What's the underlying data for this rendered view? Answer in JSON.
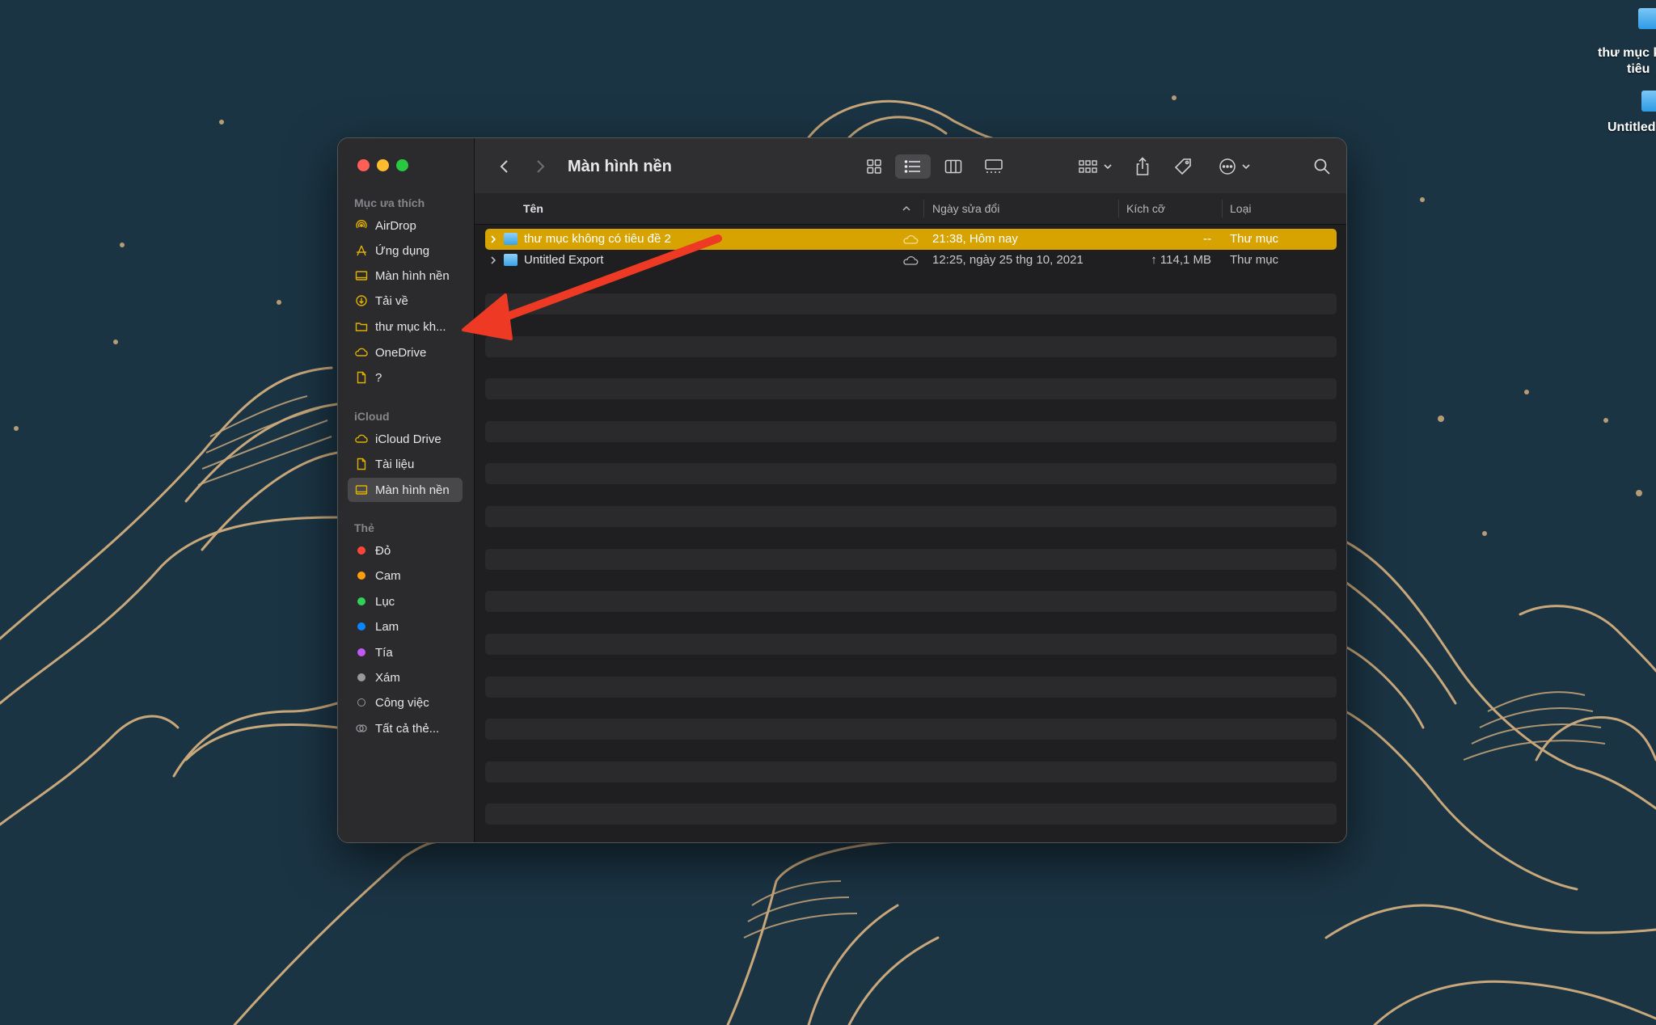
{
  "desktop": {
    "icons": [
      {
        "label_line1": "thư mục k",
        "label_line2": "tiêu"
      },
      {
        "label_line1": "Untitled",
        "label_line2": ""
      }
    ]
  },
  "window": {
    "title": "Màn hình nền",
    "sidebar": {
      "favorites_header": "Mục ưa thích",
      "favorites": [
        {
          "label": "AirDrop",
          "icon": "airdrop-icon"
        },
        {
          "label": "Ứng dụng",
          "icon": "applications-icon"
        },
        {
          "label": "Màn hình nền",
          "icon": "desktop-icon"
        },
        {
          "label": "Tải về",
          "icon": "download-icon"
        },
        {
          "label": "thư mục kh...",
          "icon": "folder-icon"
        },
        {
          "label": "OneDrive",
          "icon": "cloud-icon"
        },
        {
          "label": "?",
          "icon": "document-icon"
        }
      ],
      "icloud_header": "iCloud",
      "icloud": [
        {
          "label": "iCloud Drive",
          "icon": "cloud-icon"
        },
        {
          "label": "Tài liệu",
          "icon": "document-icon"
        },
        {
          "label": "Màn hình nền",
          "icon": "desktop-icon",
          "active": true
        }
      ],
      "tags_header": "Thẻ",
      "tags": [
        {
          "label": "Đỏ",
          "color": "#ff453a"
        },
        {
          "label": "Cam",
          "color": "#ff9f0a"
        },
        {
          "label": "Lục",
          "color": "#30d158"
        },
        {
          "label": "Lam",
          "color": "#0a84ff"
        },
        {
          "label": "Tía",
          "color": "#bf5af2"
        },
        {
          "label": "Xám",
          "color": "#98989d"
        },
        {
          "label": "Công việc",
          "color": "outline"
        },
        {
          "label": "Tất cả thẻ...",
          "color": "outline-multi"
        }
      ]
    },
    "columns": {
      "name": "Tên",
      "date": "Ngày sửa đổi",
      "size": "Kích cỡ",
      "kind": "Loại"
    },
    "rows": [
      {
        "name": "thư mục không có tiêu đề 2",
        "date": "21:38, Hôm nay",
        "size": "--",
        "kind": "Thư mục",
        "selected": true
      },
      {
        "name": "Untitled Export",
        "date": "12:25, ngày 25 thg 10, 2021",
        "size": "↑ 114,1 MB",
        "kind": "Thư mục",
        "selected": false
      }
    ]
  },
  "colors": {
    "selection": "#d6a300",
    "arrow": "#ee3a24",
    "wallpaper": "#1b3444",
    "line_art": "#c8a77a"
  }
}
